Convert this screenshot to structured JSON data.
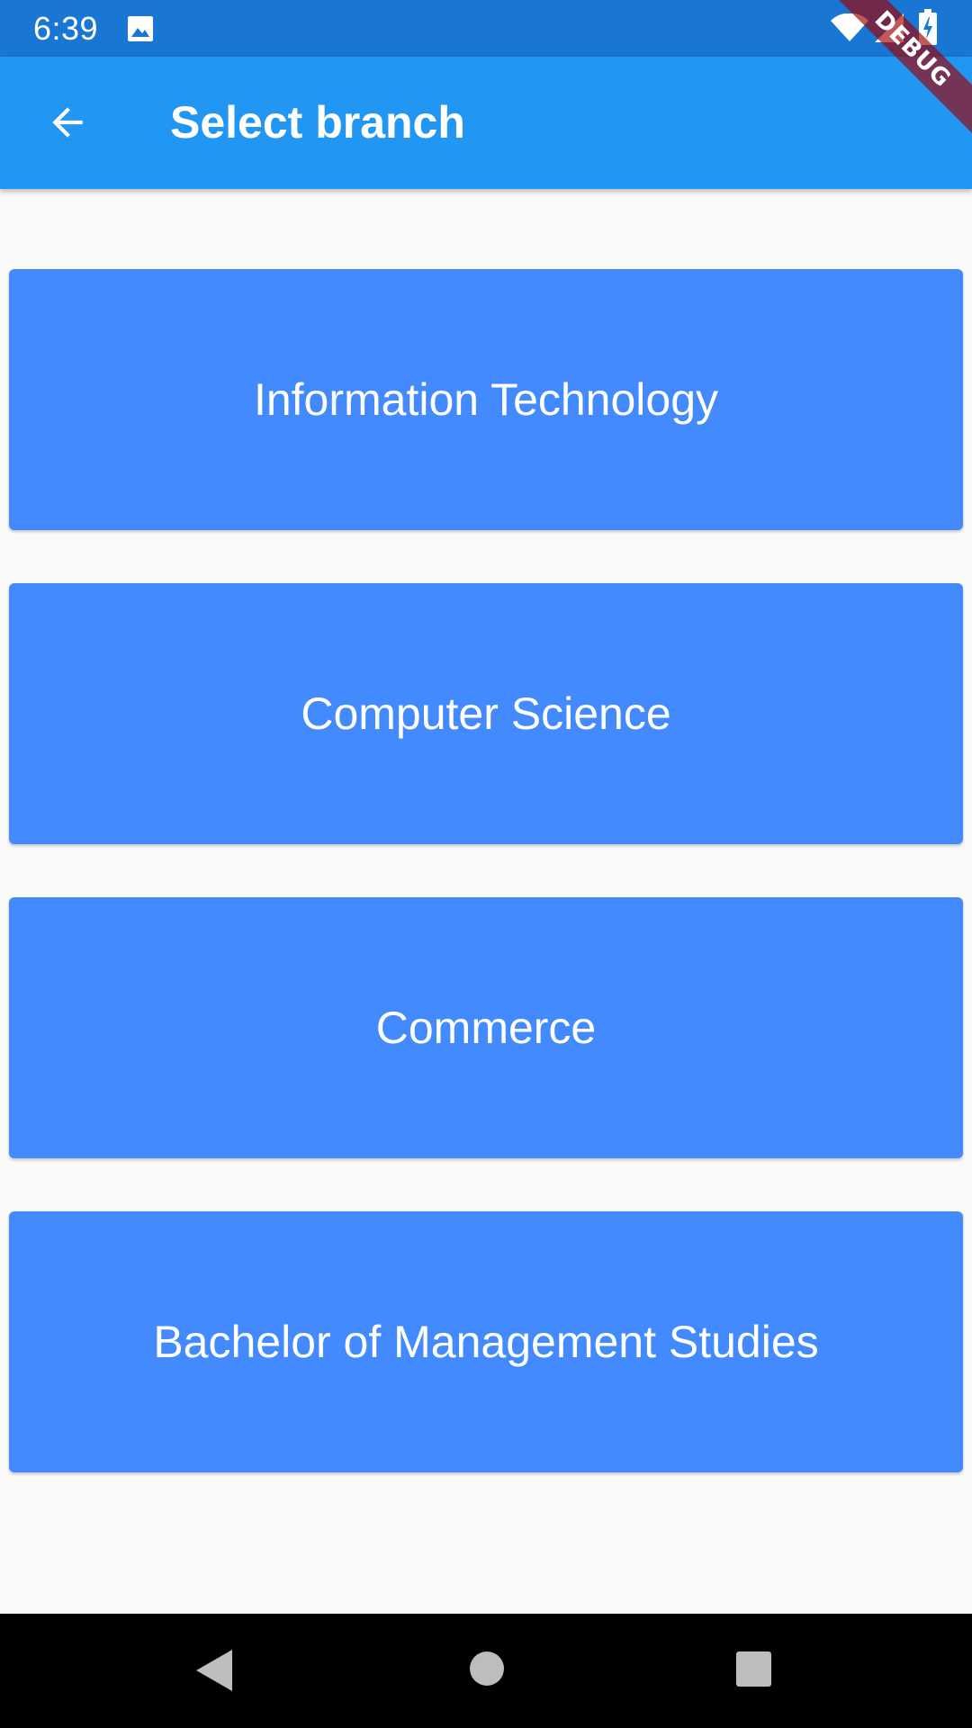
{
  "status_bar": {
    "time": "6:39",
    "icons": [
      "photo-icon",
      "wifi-icon",
      "signal-icon",
      "battery-charging-icon"
    ]
  },
  "debug_banner": {
    "label": "DEBUG"
  },
  "app_bar": {
    "back_icon": "arrow-back-icon",
    "title": "Select branch",
    "color": "#2196F3"
  },
  "branches": [
    {
      "label": "Information Technology"
    },
    {
      "label": "Computer Science"
    },
    {
      "label": "Commerce"
    },
    {
      "label": "Bachelor of Management Studies"
    }
  ],
  "colors": {
    "status_bar": "#1976D2",
    "card": "#448AFF",
    "background": "#FAFAFA"
  },
  "nav_bar": {
    "icons": [
      "nav-back-icon",
      "nav-home-icon",
      "nav-recents-icon"
    ]
  }
}
